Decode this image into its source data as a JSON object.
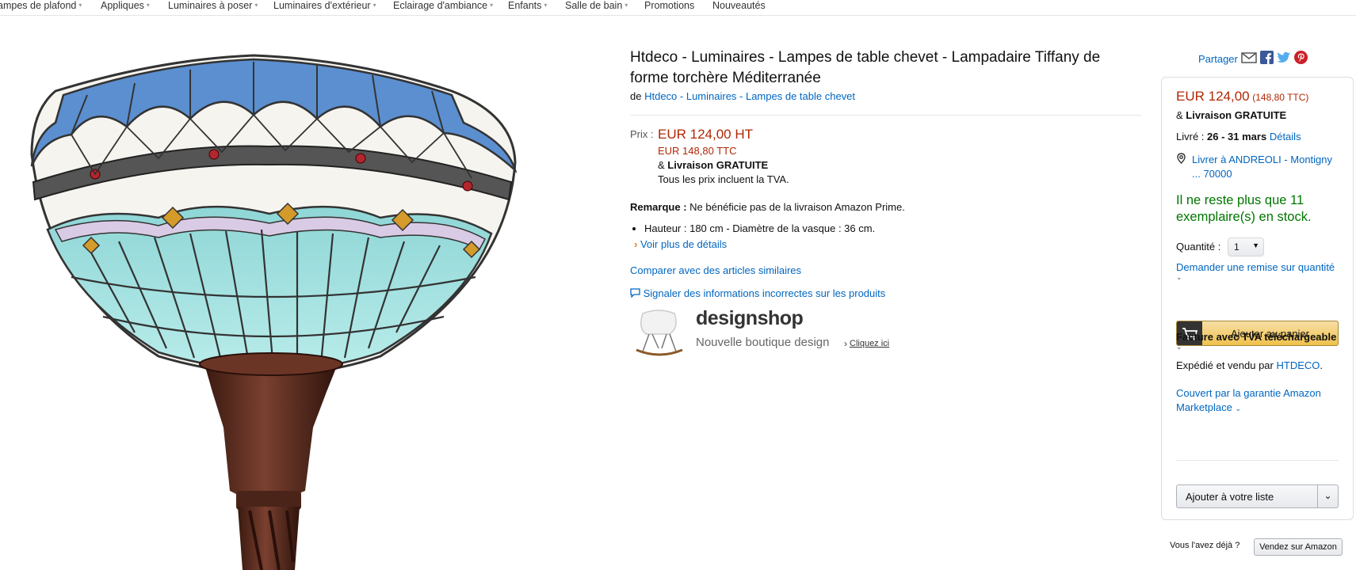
{
  "nav": {
    "items": [
      "ampes de plafond",
      "Appliques",
      "Luminaires à poser",
      "Luminaires d'extérieur",
      "Eclairage d'ambiance",
      "Enfants",
      "Salle de bain",
      "Promotions",
      "Nouveautés"
    ]
  },
  "product": {
    "title": "Htdeco - Luminaires - Lampes de table chevet - Lampadaire Tiffany de forme torchère Méditerranée",
    "by_prefix": "de",
    "brand_link": "Htdeco - Luminaires - Lampes de table chevet",
    "price_label": "Prix :",
    "price_ht": "EUR 124,00 HT",
    "price_ttc": "EUR 148,80 TTC",
    "delivery_prefix": "&",
    "delivery_free": "Livraison GRATUITE",
    "tva_note": "Tous les prix incluent la TVA.",
    "remark_label": "Remarque :",
    "remark_text": "Ne bénéficie pas de la livraison Amazon Prime.",
    "bullets": [
      "Hauteur : 180 cm - Diamètre de la vasque : 36 cm."
    ],
    "more_details": "Voir plus de détails",
    "compare": "Comparer avec des articles similaires",
    "report": "Signaler des informations incorrectes sur les produits"
  },
  "banner": {
    "brand": "designshop",
    "tagline": "Nouvelle boutique design",
    "cta": "Cliquez ici"
  },
  "share": {
    "label": "Partager"
  },
  "buybox": {
    "price": "EUR 124,00",
    "price_ttc": "(148,80 TTC)",
    "delivery_prefix": "&",
    "delivery": "Livraison GRATUITE",
    "delivered_label": "Livré :",
    "delivered_dates": "26 - 31 mars",
    "details_link": "Détails",
    "deliver_to": "Livrer à ANDREOLI - Montigny ... 70000",
    "stock": "Il ne reste plus que 11 exemplaire(s) en stock.",
    "quantity_label": "Quantité :",
    "quantity_value": "1",
    "bulk_discount": "Demander une remise sur quantité",
    "add_to_cart": "Ajouter au panier",
    "invoice": "Facture avec TVA téléchargeable",
    "shipped_prefix": "Expédié et vendu par",
    "seller": "HTDECO",
    "guarantee": "Couvert par la garantie Amazon Marketplace",
    "add_to_list": "Ajouter à votre liste"
  },
  "sell": {
    "question": "Vous l'avez déjà ?",
    "button": "Vendez sur Amazon"
  },
  "colors": {
    "price": "#b12704",
    "link": "#0066c0",
    "stock": "#007600",
    "accent": "#f0c14b"
  }
}
